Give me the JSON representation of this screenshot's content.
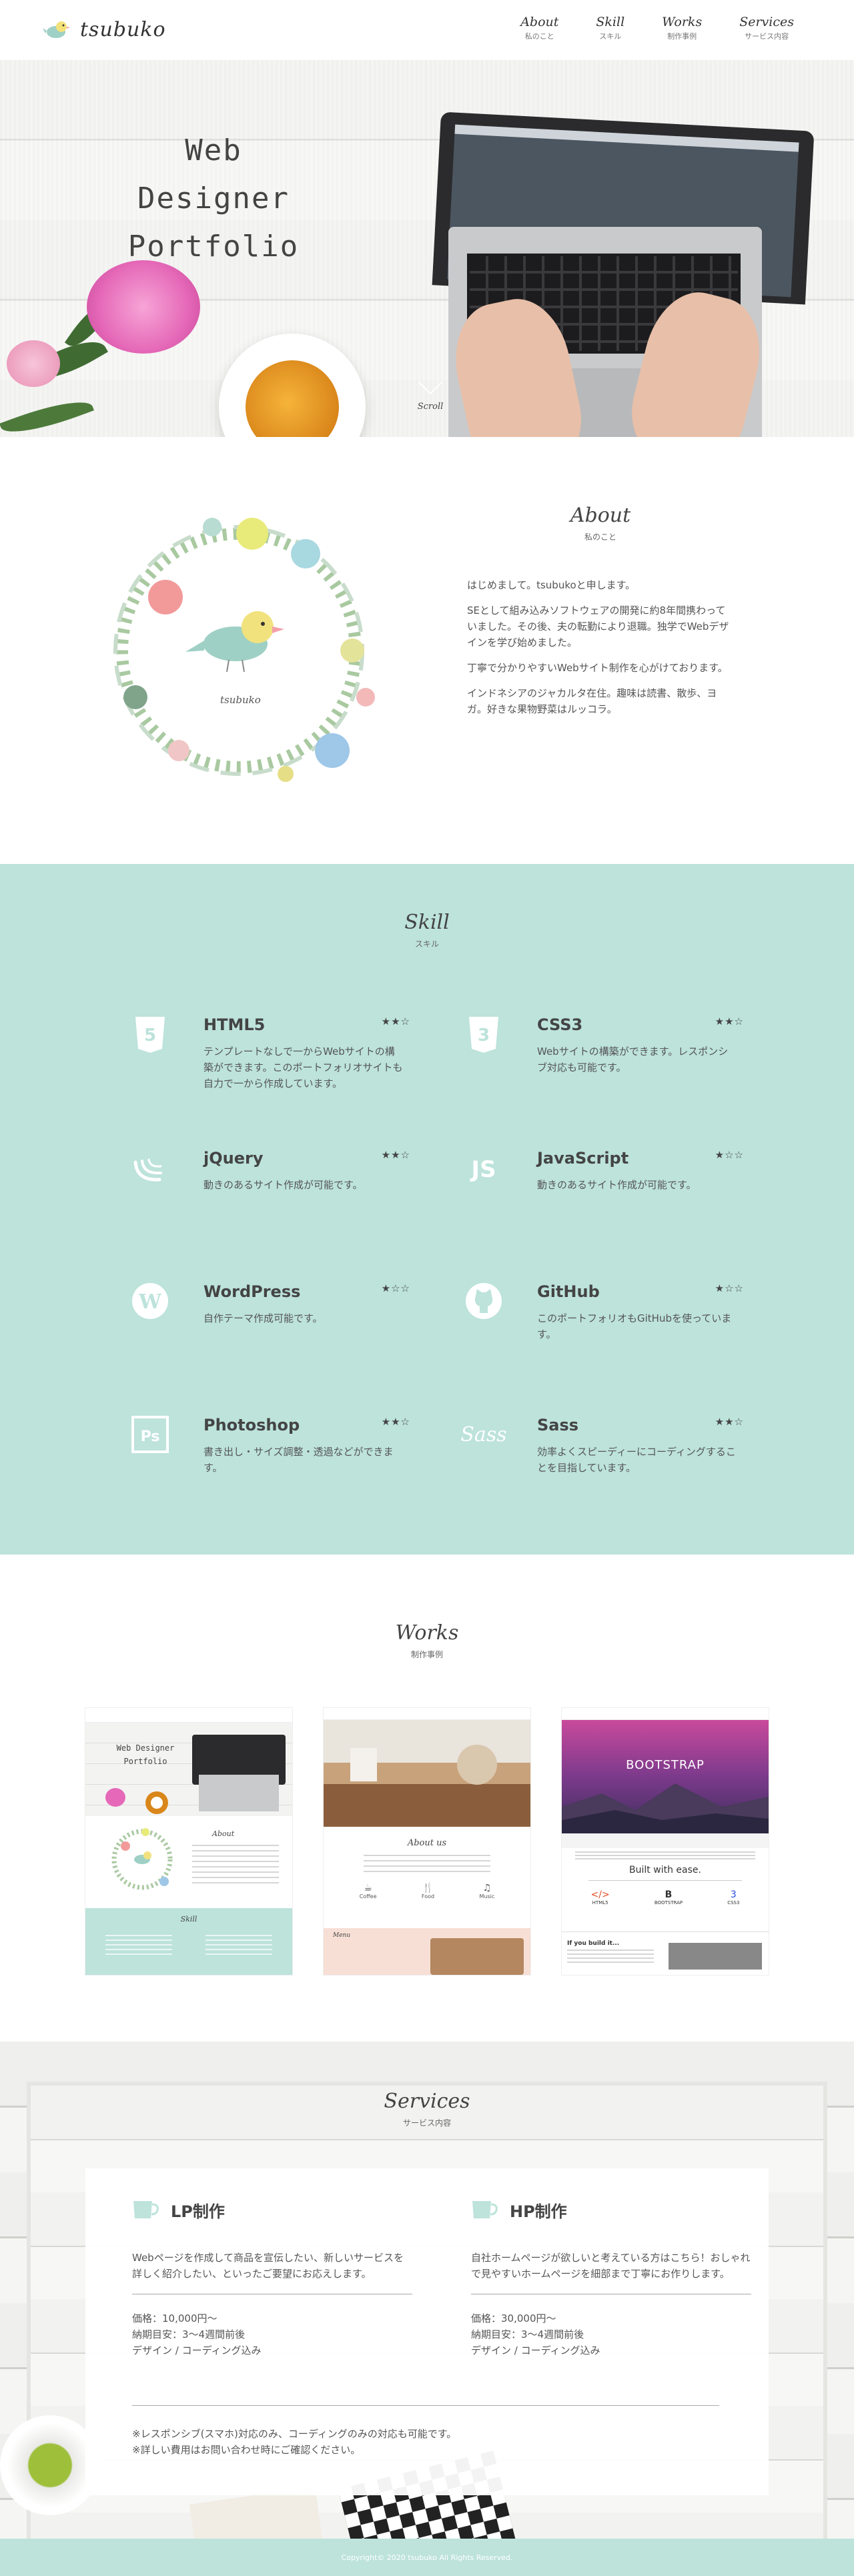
{
  "header": {
    "logo_text": "tsubuko",
    "nav": [
      {
        "en": "About",
        "ja": "私のこと"
      },
      {
        "en": "Skill",
        "ja": "スキル"
      },
      {
        "en": "Works",
        "ja": "制作事例"
      },
      {
        "en": "Services",
        "ja": "サービス内容"
      }
    ]
  },
  "hero": {
    "title_line1": "Web Designer",
    "title_line2": "Portfolio",
    "scroll_label": "Scroll"
  },
  "about": {
    "title_en": "About",
    "title_ja": "私のこと",
    "wreath_caption": "tsubuko",
    "paragraphs": [
      "はじめまして。tsubukoと申します。",
      "SEとして組み込みソフトウェアの開発に約8年間携わっていました。その後、夫の転勤により退職。独学でWebデザインを学び始めました。",
      "丁寧で分かりやすいWebサイト制作を心がけております。",
      "インドネシアのジャカルタ在住。趣味は読書、散歩、ヨガ。好きな果物野菜はルッコラ。"
    ]
  },
  "skill": {
    "title_en": "Skill",
    "title_ja": "スキル",
    "items": [
      {
        "name": "HTML5",
        "stars": "★★☆",
        "icon": "html5-icon",
        "desc": "テンプレートなしで一からWebサイトの構築ができます。このポートフォリオサイトも自力で一から作成しています。"
      },
      {
        "name": "CSS3",
        "stars": "★★☆",
        "icon": "css3-icon",
        "desc": "Webサイトの構築ができます。レスポンシブ対応も可能です。"
      },
      {
        "name": "jQuery",
        "stars": "★★☆",
        "icon": "jquery-icon",
        "desc": "動きのあるサイト作成が可能です。"
      },
      {
        "name": "JavaScript",
        "stars": "★☆☆",
        "icon": "javascript-icon",
        "desc": "動きのあるサイト作成が可能です。"
      },
      {
        "name": "WordPress",
        "stars": "★☆☆",
        "icon": "wordpress-icon",
        "desc": "自作テーマ作成可能です。"
      },
      {
        "name": "GitHub",
        "stars": "★☆☆",
        "icon": "github-icon",
        "desc": "このポートフォリオもGitHubを使っています。"
      },
      {
        "name": "Photoshop",
        "stars": "★★☆",
        "icon": "photoshop-icon",
        "desc": "書き出し・サイズ調整・透過などができます。"
      },
      {
        "name": "Sass",
        "stars": "★★☆",
        "icon": "sass-icon",
        "desc": "効率よくスピーディーにコーディングすることを目指しています。"
      }
    ]
  },
  "works": {
    "title_en": "Works",
    "title_ja": "制作事例",
    "cards": [
      {
        "kind": "portfolio",
        "thumb_title1": "Web Designer",
        "thumb_title2": "Portfolio",
        "thumb_about": "About",
        "thumb_skill": "Skill"
      },
      {
        "kind": "cafe",
        "thumb_about": "About us",
        "thumb_items": [
          "Coffee",
          "Food",
          "Music"
        ],
        "thumb_menu": "Menu"
      },
      {
        "kind": "bootstrap",
        "thumb_hero": "BOOTSTRAP",
        "thumb_heading": "Built with ease.",
        "thumb_items": [
          "HTML5",
          "BOOTSTRAP",
          "CSS3"
        ],
        "thumb_bottom": "If you build it..."
      }
    ]
  },
  "services": {
    "title_en": "Services",
    "title_ja": "サービス内容",
    "items": [
      {
        "name": "LP制作",
        "desc": "Webページを作成して商品を宣伝したい、新しいサービスを詳しく紹介したい、といったご要望にお応えします。",
        "price": "価格：10,000円〜",
        "period": "納期目安：3〜4週間前後",
        "scope": "デザイン / コーディング込み"
      },
      {
        "name": "HP制作",
        "desc": "自社ホームページが欲しいと考えている方はこちら！おしゃれで見やすいホームページを細部まで丁寧にお作りします。",
        "price": "価格：30,000円〜",
        "period": "納期目安：3〜4週間前後",
        "scope": "デザイン / コーディング込み"
      }
    ],
    "note1": "※レスポンシブ(スマホ)対応のみ、コーディングのみの対応も可能です。",
    "note2": "※詳しい費用はお問い合わせ時にご確認ください。"
  },
  "footer": {
    "copyright": "Copyright© 2020 tsubuko All Rights Reserved."
  },
  "colors": {
    "accent": "#bde3db",
    "text": "#555555",
    "heading": "#444444"
  }
}
